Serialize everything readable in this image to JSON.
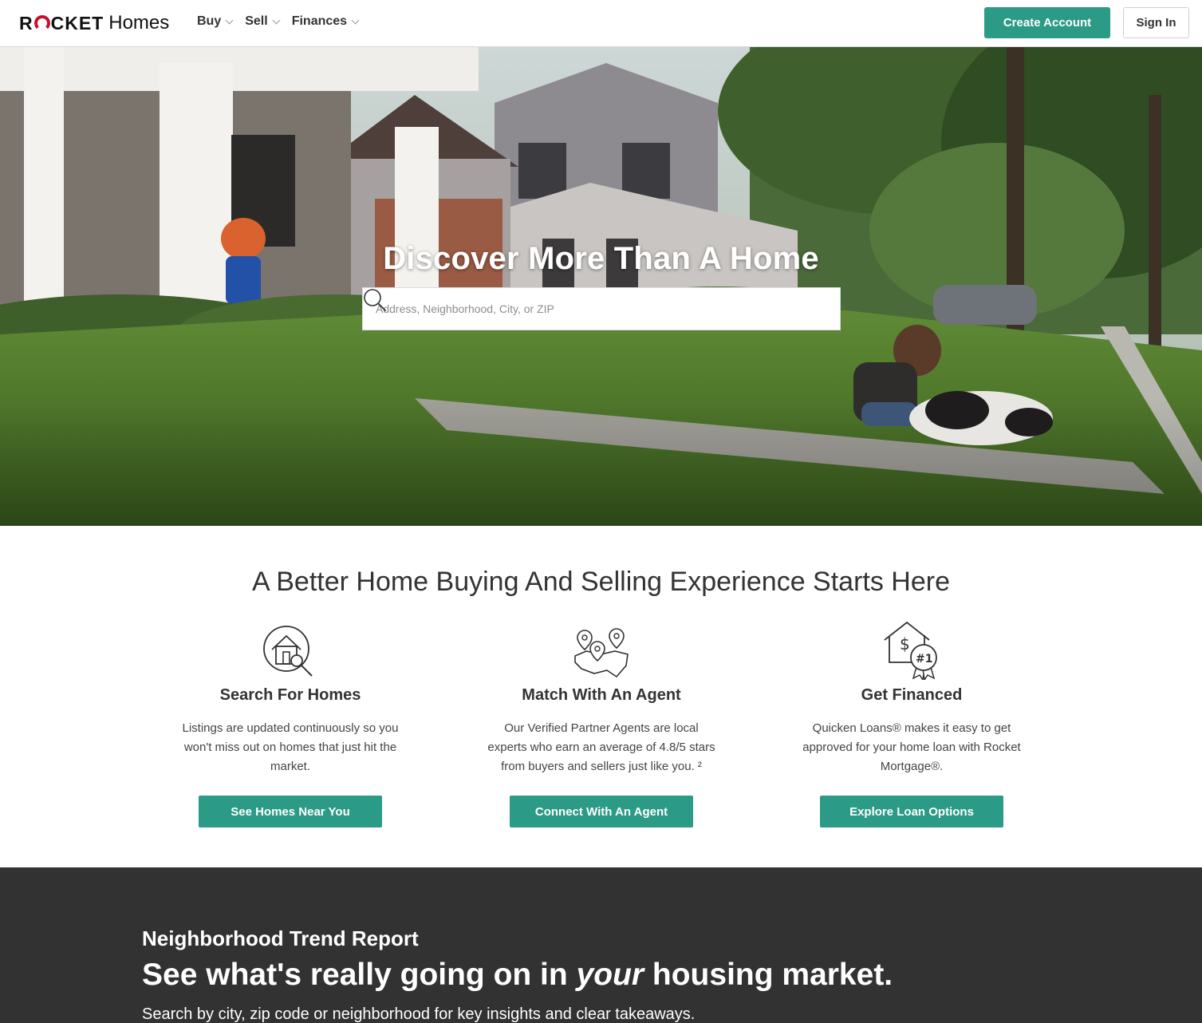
{
  "header": {
    "logo_part1": "R",
    "logo_part2": "CKET",
    "logo_part3": "Homes",
    "nav": [
      {
        "label": "Buy"
      },
      {
        "label": "Sell"
      },
      {
        "label": "Finances"
      }
    ],
    "create_account": "Create Account",
    "sign_in": "Sign In"
  },
  "hero": {
    "title": "Discover More Than A Home",
    "search_placeholder": "Address, Neighborhood, City, or ZIP"
  },
  "features": {
    "title": "A Better Home Buying And Selling Experience Starts Here",
    "items": [
      {
        "icon": "house-magnifier-icon",
        "heading": "Search For Homes",
        "desc": "Listings are updated continuously so you won't miss out on homes that just hit the market.",
        "button": "See Homes Near You"
      },
      {
        "icon": "map-pins-icon",
        "heading": "Match With An Agent",
        "desc": "Our Verified Partner Agents are local experts who earn an average of 4.8/5 stars from buyers and sellers just like you. ²",
        "button": "Connect With An Agent"
      },
      {
        "icon": "house-dollar-award-icon",
        "heading": "Get Financed",
        "desc": "Quicken Loans® makes it easy to get approved for your home loan with Rocket Mortgage®.",
        "button": "Explore Loan Options"
      }
    ]
  },
  "trend": {
    "kicker": "Neighborhood Trend Report",
    "headline_pre": "See what's really going on in ",
    "headline_em": "your",
    "headline_post": " housing market.",
    "sub": "Search by city, zip code or neighborhood for key insights and clear takeaways."
  },
  "colors": {
    "accent": "#2b9a86",
    "brand_red": "#c8102e",
    "dark_band": "#333233"
  }
}
